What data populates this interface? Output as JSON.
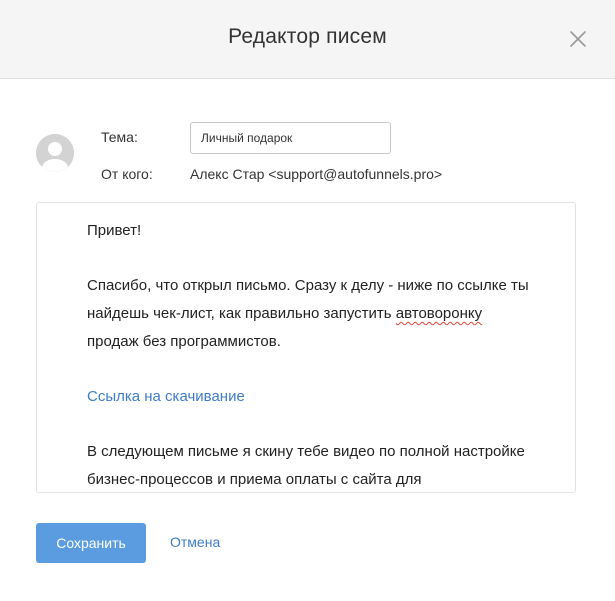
{
  "dialog": {
    "title": "Редактор писем"
  },
  "form": {
    "subject_label": "Тема:",
    "subject_value": "Личный подарок",
    "from_label": "От кого:",
    "from_value": "Алекс Стар <support@autofunnels.pro>"
  },
  "editor": {
    "greeting": "Привет!",
    "paragraph1_start": "Спасибо, что открыл письмо. Сразу к делу - ниже по ссылке ты найдешь чек-лист, как правильно запустить ",
    "paragraph1_misspelled": "автоворонку",
    "paragraph1_end": " продаж без программистов.",
    "link_text": "Ссылка на скачивание",
    "paragraph2": "В следующем письме я скину тебе видео по полной настройке бизнес-процессов и приема оплаты с сайта для"
  },
  "actions": {
    "save_label": "Сохранить",
    "cancel_label": "Отмена"
  },
  "colors": {
    "accent": "#5b9ce0",
    "link": "#3d7cc9",
    "header_bg": "#f5f5f5"
  },
  "icons": {
    "close": "close-icon",
    "avatar": "user-avatar-icon"
  }
}
